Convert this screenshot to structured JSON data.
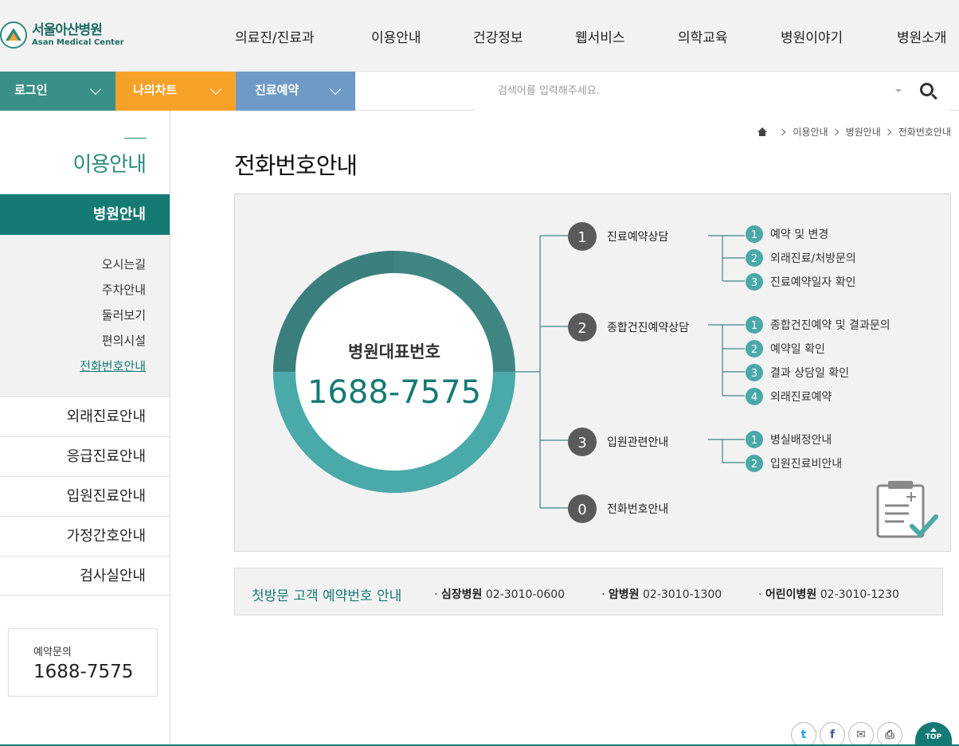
{
  "header": {
    "logo_kr": "서울아산병원",
    "logo_en": "Asan Medical Center",
    "nav": [
      "의료진/진료과",
      "이용안내",
      "건강정보",
      "웹서비스",
      "의학교육",
      "병원이야기",
      "병원소개"
    ]
  },
  "quickbar": {
    "login": "로그인",
    "mychart": "나의차트",
    "reservation": "진료예약",
    "search_placeholder": "검색어를 입력해주세요."
  },
  "sidebar": {
    "title": "이용안내",
    "active": "병원안내",
    "sub_items": [
      "오시는길",
      "주차안내",
      "둘러보기",
      "편의시설",
      "전화번호안내"
    ],
    "menus": [
      "외래진료안내",
      "응급진료안내",
      "입원진료안내",
      "가정간호안내",
      "검사실안내"
    ],
    "contact_label": "예약문의",
    "contact_number": "1688-7575"
  },
  "breadcrumb": [
    "이용안내",
    "병원안내",
    "전화번호안내"
  ],
  "page_title": "전화번호안내",
  "diagram": {
    "center_label": "병원대표번호",
    "center_number": "1688-7575",
    "branches": [
      {
        "num": "1",
        "label": "진료예약상담",
        "subs": [
          {
            "num": "1",
            "label": "예약 및 변경"
          },
          {
            "num": "2",
            "label": "외래진료/처방문의"
          },
          {
            "num": "3",
            "label": "진료예약일자 확인"
          }
        ]
      },
      {
        "num": "2",
        "label": "종합건진예약상담",
        "subs": [
          {
            "num": "1",
            "label": "종합건진예약 및 결과문의"
          },
          {
            "num": "2",
            "label": "예약일 확인"
          },
          {
            "num": "3",
            "label": "결과 상담일 확인"
          },
          {
            "num": "4",
            "label": "외래진료예약"
          }
        ]
      },
      {
        "num": "3",
        "label": "입원관련안내",
        "subs": [
          {
            "num": "1",
            "label": "병실배정안내"
          },
          {
            "num": "2",
            "label": "입원진료비안내"
          }
        ]
      },
      {
        "num": "0",
        "label": "전화번호안내",
        "subs": []
      }
    ],
    "colors": {
      "dark_circle": "#5a5a5a",
      "teal_circle": "#4aa8a8",
      "ring_dark": "#3f8682",
      "ring_light": "#4aa9a9",
      "line": "#3f8682"
    }
  },
  "notice": {
    "title": "첫방문 고객 예약번호 안내",
    "items": [
      {
        "name": "심장병원",
        "number": "02-3010-0600"
      },
      {
        "name": "암병원",
        "number": "02-3010-1300"
      },
      {
        "name": "어린이병원",
        "number": "02-3010-1230"
      }
    ]
  },
  "footer": {
    "share_icons": [
      "twitter-icon",
      "facebook-icon",
      "mail-icon",
      "print-icon"
    ],
    "top_label": "TOP"
  }
}
